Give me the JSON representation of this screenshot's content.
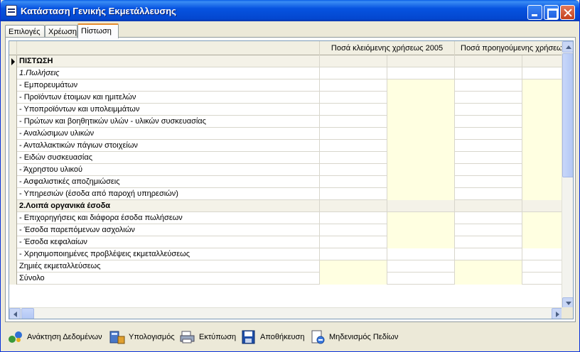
{
  "window": {
    "title": "Κατάσταση Γενικής Εκμετάλλευσης"
  },
  "tabs": [
    {
      "label": "Επιλογές"
    },
    {
      "label": "Χρέωση"
    },
    {
      "label": "Πίστωση"
    }
  ],
  "grid": {
    "columns": [
      "",
      "Ποσά κλειόμενης χρήσεως 2005",
      "Ποσά προηγούμενης χρήσεως"
    ],
    "rows": [
      {
        "label": "ΠΙΣΤΩΣΗ"
      },
      {
        "label": "1.Πωλήσεις"
      },
      {
        "label": "- Εμπορευμάτων"
      },
      {
        "label": "- Προϊόντων έτοιμων και ημιτελών"
      },
      {
        "label": "- Υποπροϊόντων και υπολειμμάτων"
      },
      {
        "label": "- Πρώτων και βοηθητικών υλών - υλικών συσκευασίας"
      },
      {
        "label": "- Αναλώσιμων υλικών"
      },
      {
        "label": "- Ανταλλακτικών πάγιων στοιχείων"
      },
      {
        "label": "- Ειδών συσκευασίας"
      },
      {
        "label": "- Άχρηστου υλικού"
      },
      {
        "label": "- Ασφαλιστικές αποζημιώσεις"
      },
      {
        "label": "- Υπηρεσιών (έσοδα από παροχή υπηρεσιών)"
      },
      {
        "label": "2.Λοιπά οργανικά έσοδα"
      },
      {
        "label": "- Επιχορηγήσεις και διάφορα έσοδα πωλήσεων"
      },
      {
        "label": "- Έσοδα παρεπόμενων ασχολιών"
      },
      {
        "label": "- Έσοδα κεφαλαίων"
      },
      {
        "label": "- Χρησιμοποιημένες προβλέψεις εκμεταλλεύσεως"
      },
      {
        "label": "Ζημιές εκμεταλλεύσεως"
      },
      {
        "label": "Σύνολο"
      }
    ]
  },
  "toolbar": {
    "load": "Ανάκτηση Δεδομένων",
    "calculate": "Υπολογισμός",
    "print": "Εκτύπωση",
    "save": "Αποθήκευση",
    "clear": "Μηδενισμός Πεδίων"
  },
  "colors": {
    "title_bar": "#0553e0",
    "editable_cell": "#ffffe1",
    "section_row": "#f4f2e8"
  }
}
